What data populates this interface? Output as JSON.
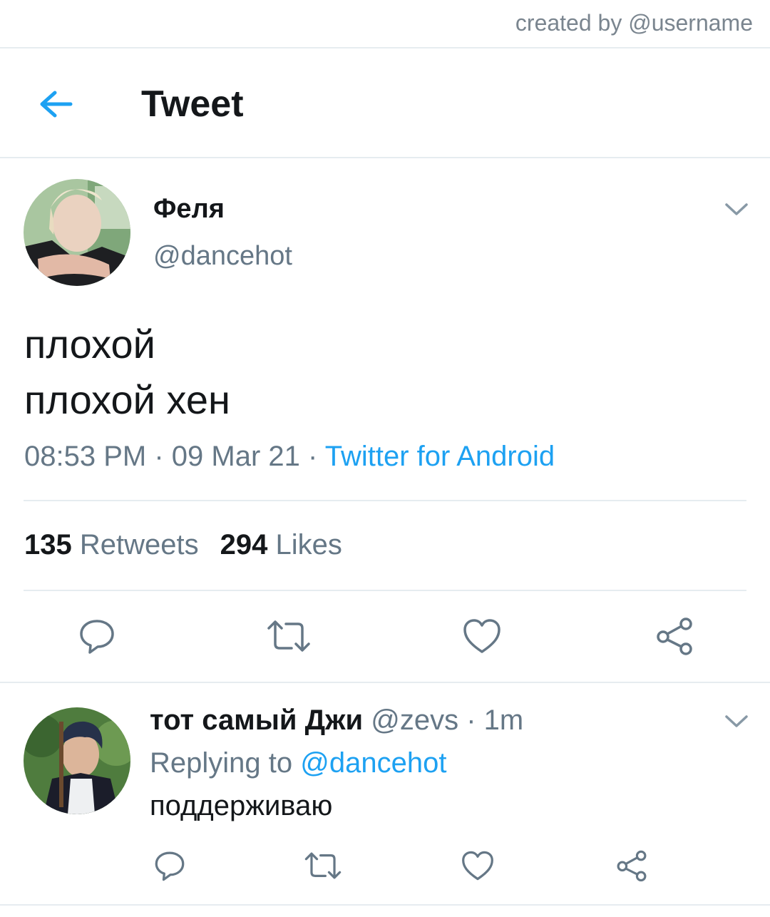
{
  "credit": "created by @username",
  "header": {
    "title": "Tweet",
    "back_icon": "arrow-left-icon"
  },
  "tweet": {
    "author_name": "Феля",
    "author_handle": "@dancehot",
    "text_lines": [
      "плохой",
      "плохой хен"
    ],
    "time": "08:53 PM",
    "date": "09 Mar 21",
    "source": "Twitter for Android",
    "separator": "·",
    "retweets_count": "135",
    "retweets_label": "Retweets",
    "likes_count": "294",
    "likes_label": "Likes",
    "actions": [
      "reply-icon",
      "retweet-icon",
      "like-icon",
      "share-icon"
    ]
  },
  "reply": {
    "author_name": "тот самый Джи",
    "author_handle": "@zevs",
    "separator": "·",
    "time": "1m",
    "replying_label": "Replying to",
    "replying_mention": "@dancehot",
    "text": "поддерживаю",
    "actions": [
      "reply-icon",
      "retweet-icon",
      "like-icon",
      "share-icon"
    ]
  },
  "colors": {
    "accent": "#1da1f2",
    "secondary_text": "#657786",
    "primary_text": "#14171a",
    "divider": "#e6ecf0"
  }
}
